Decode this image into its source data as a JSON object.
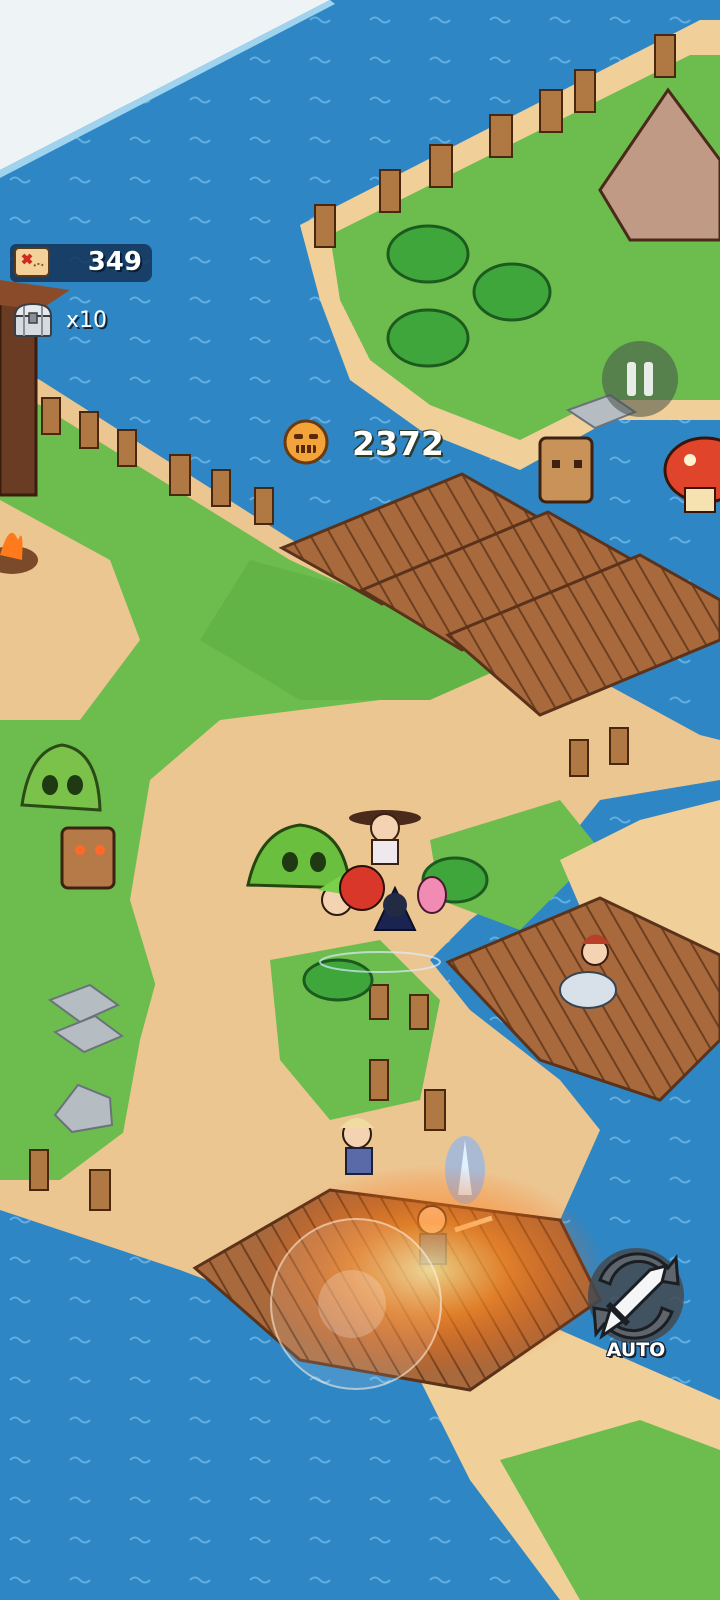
{
  "hud": {
    "map_count": "349",
    "chest_count": "x10",
    "coin_count": "2372",
    "auto_label": "AUTO"
  },
  "icons": {
    "map": "treasure-map-icon",
    "chest": "treasure-chest-icon",
    "coin": "tribal-mask-coin-icon",
    "pause": "pause-icon",
    "auto": "auto-attack-sword-icon"
  },
  "colors": {
    "water": "#2f86c4",
    "grass": "#6cbd4e",
    "sand": "#ecc691",
    "wood": "#a3653a",
    "snow": "#eef3f5",
    "fire": "#ff8a1f"
  }
}
